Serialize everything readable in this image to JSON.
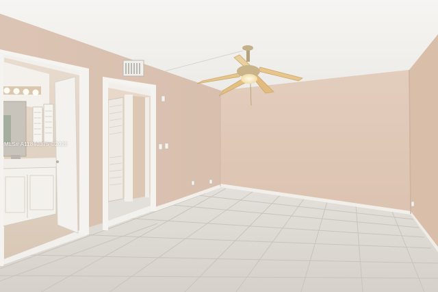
{
  "photo": {
    "watermark": "MLS# A11840375 ©2025"
  },
  "colors": {
    "wall_left": "#dcc4b4",
    "wall_back": "#e2cbbb",
    "wall_right": "#dbc1ae",
    "ceiling": "#f3f2ef",
    "floor": "#dedad4",
    "trim": "#f4f2ee",
    "fan_blade": "#e8c58a",
    "cabinet": "#f3f1ec"
  },
  "fixtures": [
    {
      "name": "ceiling-fan",
      "blades": 5,
      "light": "on"
    },
    {
      "name": "ac-vent",
      "type": "return-grille"
    },
    {
      "name": "closet-door",
      "style": "louvered"
    }
  ]
}
